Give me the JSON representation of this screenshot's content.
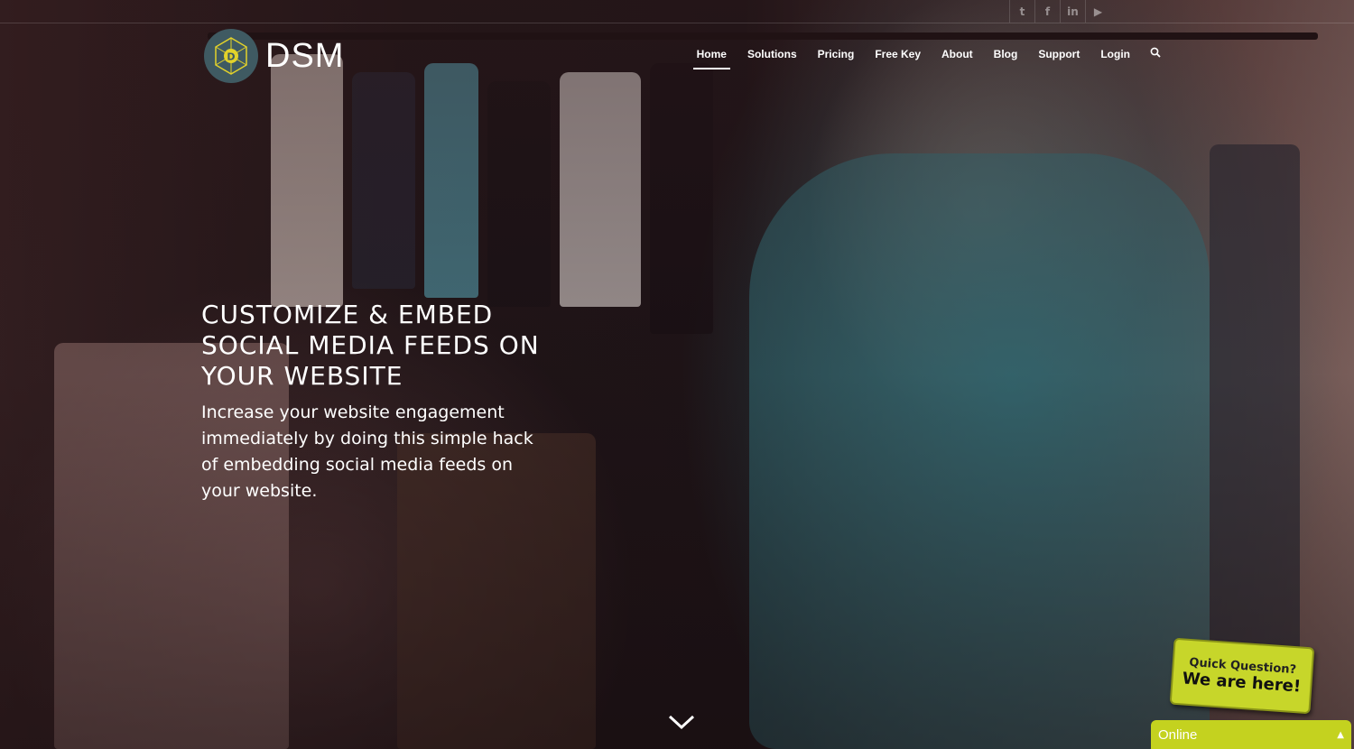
{
  "social": {
    "items": [
      {
        "name": "twitter",
        "glyph": "t"
      },
      {
        "name": "facebook",
        "glyph": "f"
      },
      {
        "name": "linkedin",
        "glyph": "in"
      },
      {
        "name": "youtube",
        "glyph": "▶"
      }
    ]
  },
  "brand": {
    "name": "DSM",
    "mark_letter": "D"
  },
  "nav": {
    "items": [
      "Home",
      "Solutions",
      "Pricing",
      "Free Key",
      "About",
      "Blog",
      "Support",
      "Login"
    ],
    "active": "Home"
  },
  "hero": {
    "headline": "Customize & Embed Social Media Feeds On Your Website",
    "subtext": "Increase your website engagement immediately by doing this simple hack of embedding social media feeds on your website."
  },
  "chat": {
    "badge_line1": "Quick Question?",
    "badge_line2": "We are here!",
    "status": "Online"
  },
  "colors": {
    "chat_accent": "#c4d21f",
    "logo_bg": "#3f5a62",
    "logo_accent": "#e3d22a"
  }
}
